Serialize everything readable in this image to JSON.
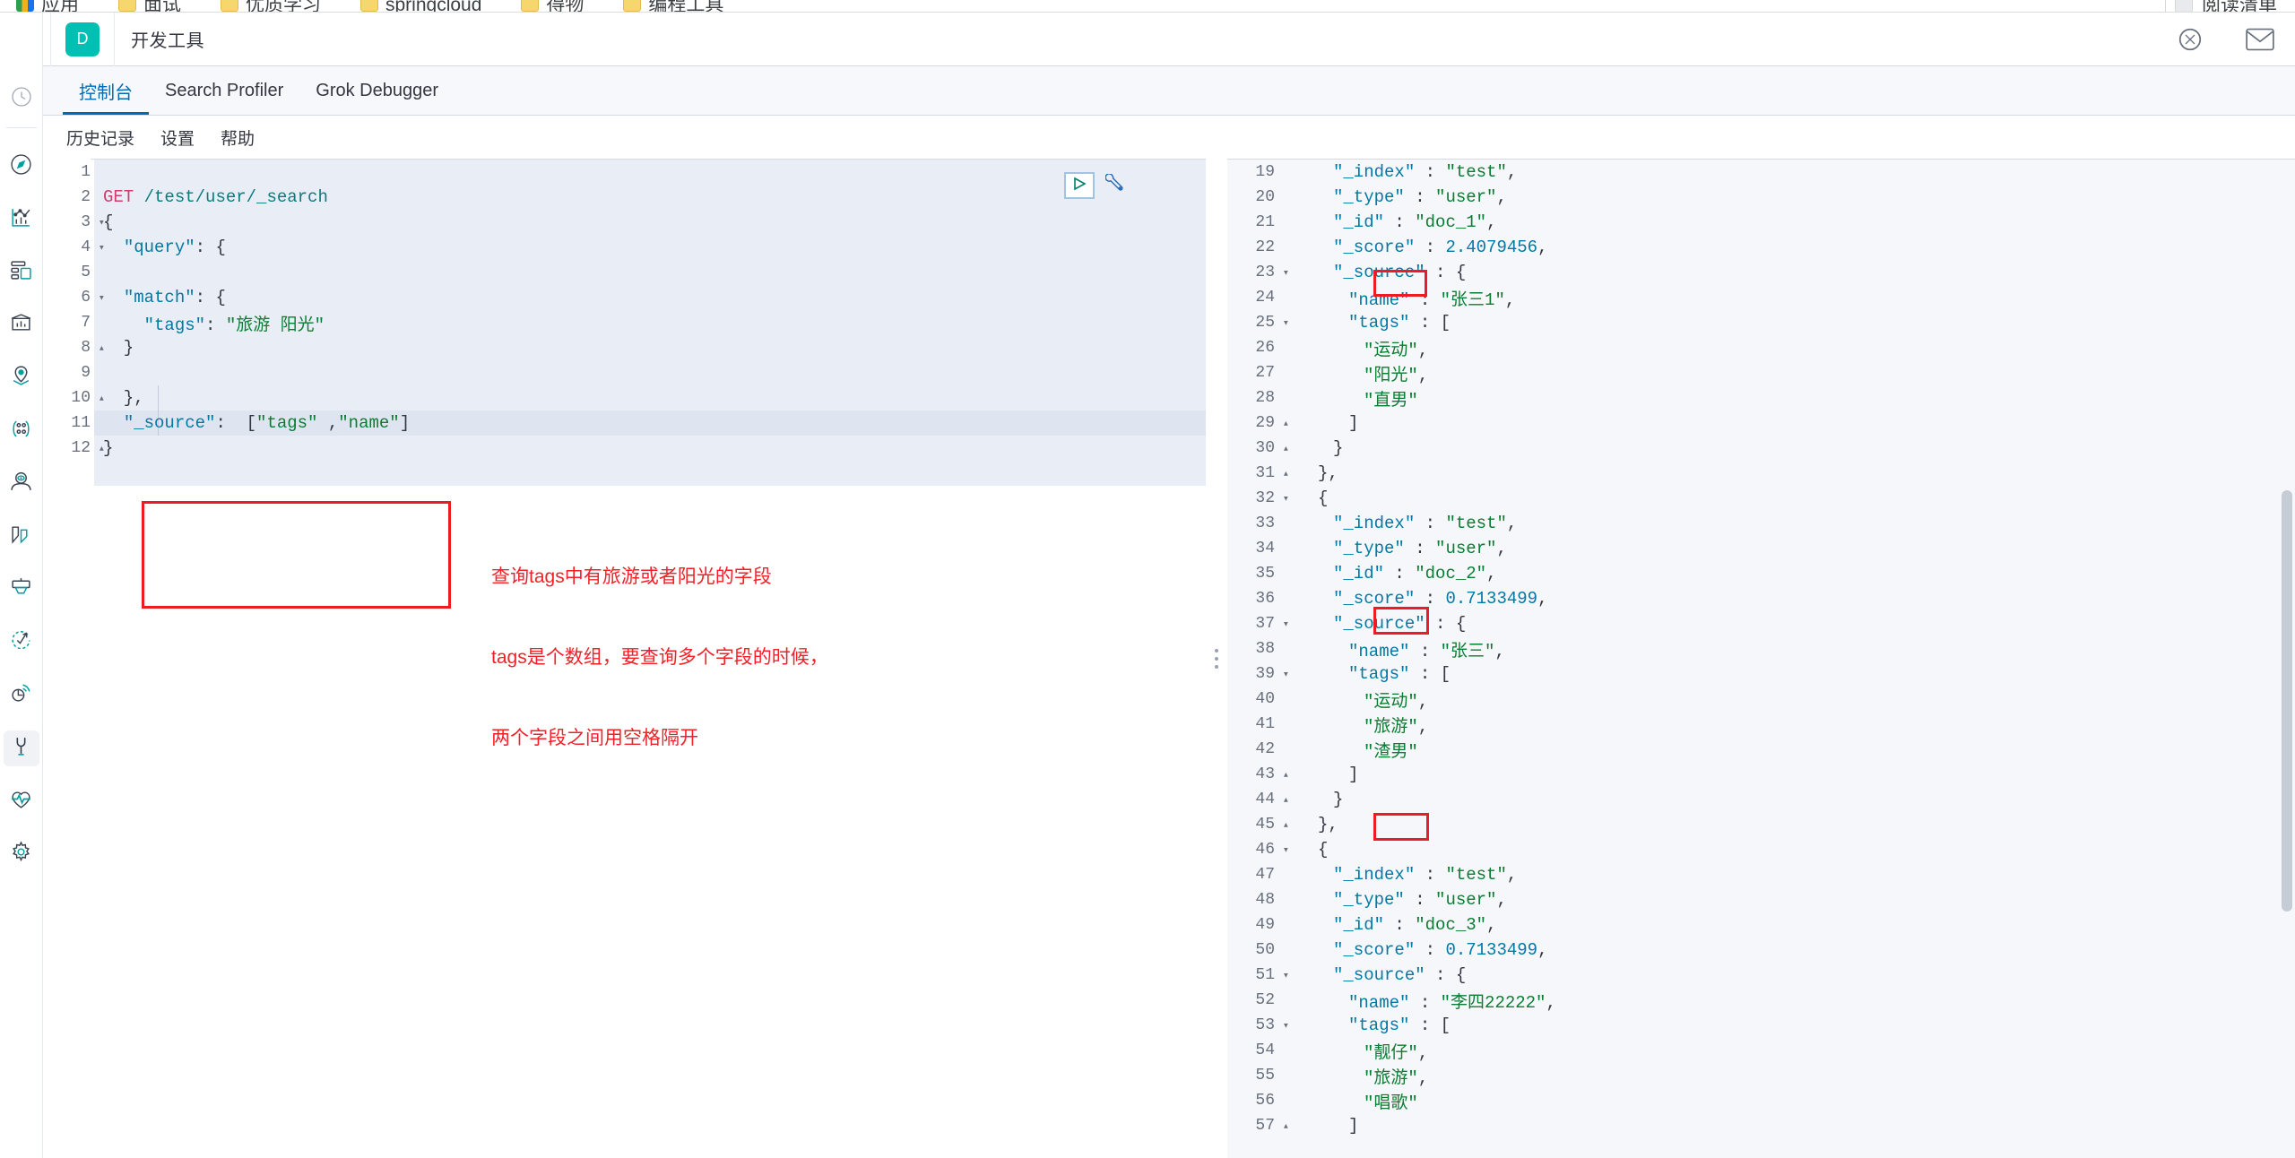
{
  "browser": {
    "bookmarks": [
      {
        "label": "应用",
        "icon": "apps-grid-icon"
      },
      {
        "label": "面试",
        "icon": "folder-icon"
      },
      {
        "label": "优质学习",
        "icon": "folder-icon"
      },
      {
        "label": "springcloud",
        "icon": "folder-icon"
      },
      {
        "label": "得物",
        "icon": "folder-icon"
      },
      {
        "label": "编程工具",
        "icon": "folder-icon"
      }
    ],
    "reading_list": "阅读清单"
  },
  "header": {
    "logo": "kibana-logo",
    "space_initial": "D",
    "app_title": "开发工具",
    "icons": [
      "help-circle-icon",
      "mail-icon"
    ]
  },
  "sidebar": {
    "items": [
      {
        "name": "recently-viewed",
        "icon": "clock-icon",
        "active": false
      },
      {
        "name": "discover",
        "icon": "compass-icon",
        "active": false
      },
      {
        "name": "visualize",
        "icon": "bar-line-chart-icon",
        "active": false
      },
      {
        "name": "dashboard",
        "icon": "dashboard-panels-icon",
        "active": false
      },
      {
        "name": "canvas",
        "icon": "presentation-icon",
        "active": false
      },
      {
        "name": "maps",
        "icon": "map-pin-icon",
        "active": false
      },
      {
        "name": "graph",
        "icon": "graph-nodes-icon",
        "active": false
      },
      {
        "name": "machine-learning",
        "icon": "ml-person-icon",
        "active": false
      },
      {
        "name": "infrastructure",
        "icon": "infrastructure-icon",
        "active": false
      },
      {
        "name": "logs",
        "icon": "logs-console-icon",
        "active": false
      },
      {
        "name": "uptime",
        "icon": "uptime-check-icon",
        "active": false
      },
      {
        "name": "apm",
        "icon": "apm-signal-icon",
        "active": false
      },
      {
        "name": "dev-tools",
        "icon": "wrench-icon",
        "active": true
      },
      {
        "name": "monitoring",
        "icon": "heartbeat-icon",
        "active": false
      },
      {
        "name": "management",
        "icon": "gear-icon",
        "active": false
      }
    ]
  },
  "tabs": [
    {
      "label": "控制台",
      "active": true
    },
    {
      "label": "Search Profiler",
      "active": false
    },
    {
      "label": "Grok Debugger",
      "active": false
    }
  ],
  "menu": [
    {
      "label": "历史记录"
    },
    {
      "label": "设置"
    },
    {
      "label": "帮助"
    }
  ],
  "editor_actions": {
    "play": "send-request-play-icon",
    "wrench": "open-documentation-wrench-icon"
  },
  "request_editor": {
    "lines": [
      {
        "n": "1",
        "fold": "",
        "tokens": []
      },
      {
        "n": "2",
        "fold": "",
        "tokens": [
          {
            "t": "method",
            "v": "GET"
          },
          {
            "t": "plain",
            "v": " "
          },
          {
            "t": "url",
            "v": "/test/user/_search"
          }
        ]
      },
      {
        "n": "3",
        "fold": "▾",
        "tokens": [
          {
            "t": "punc",
            "v": "{"
          }
        ]
      },
      {
        "n": "4",
        "fold": "▾",
        "tokens": [
          {
            "t": "punc",
            "v": "  "
          },
          {
            "t": "key",
            "v": "\"query\""
          },
          {
            "t": "punc",
            "v": ": {"
          }
        ]
      },
      {
        "n": "5",
        "fold": "",
        "tokens": []
      },
      {
        "n": "6",
        "fold": "▾",
        "tokens": [
          {
            "t": "punc",
            "v": "  "
          },
          {
            "t": "key",
            "v": "\"match\""
          },
          {
            "t": "punc",
            "v": ": {"
          }
        ]
      },
      {
        "n": "7",
        "fold": "",
        "tokens": [
          {
            "t": "punc",
            "v": "    "
          },
          {
            "t": "key",
            "v": "\"tags\""
          },
          {
            "t": "punc",
            "v": ": "
          },
          {
            "t": "str",
            "v": "\"旅游 阳光\""
          }
        ]
      },
      {
        "n": "8",
        "fold": "▴",
        "tokens": [
          {
            "t": "punc",
            "v": "  }"
          }
        ]
      },
      {
        "n": "9",
        "fold": "",
        "tokens": []
      },
      {
        "n": "10",
        "fold": "▴",
        "tokens": [
          {
            "t": "punc",
            "v": "  },"
          }
        ]
      },
      {
        "n": "11",
        "fold": "",
        "tokens": [
          {
            "t": "punc",
            "v": "  "
          },
          {
            "t": "key",
            "v": "\"_source\""
          },
          {
            "t": "punc",
            "v": ":  ["
          },
          {
            "t": "str",
            "v": "\"tags\""
          },
          {
            "t": "punc",
            "v": " ,"
          },
          {
            "t": "str",
            "v": "\"name\""
          },
          {
            "t": "punc",
            "v": "]"
          }
        ]
      },
      {
        "n": "12",
        "fold": "▴",
        "tokens": [
          {
            "t": "punc",
            "v": "}"
          }
        ]
      }
    ],
    "highlighted_line": "11"
  },
  "annotation": {
    "color": "#f42028",
    "lines": [
      "查询tags中有旅游或者阳光的字段",
      "tags是个数组，要查询多个字段的时候，",
      "两个字段之间用空格隔开"
    ]
  },
  "response_viewer": {
    "lines": [
      {
        "n": "19",
        "fold": "",
        "indent": 3,
        "tokens": [
          {
            "t": "key",
            "v": "\"_index\""
          },
          {
            "t": "punc",
            "v": " : "
          },
          {
            "t": "str",
            "v": "\"test\""
          },
          {
            "t": "punc",
            "v": ","
          }
        ]
      },
      {
        "n": "20",
        "fold": "",
        "indent": 3,
        "tokens": [
          {
            "t": "key",
            "v": "\"_type\""
          },
          {
            "t": "punc",
            "v": " : "
          },
          {
            "t": "str",
            "v": "\"user\""
          },
          {
            "t": "punc",
            "v": ","
          }
        ]
      },
      {
        "n": "21",
        "fold": "",
        "indent": 3,
        "tokens": [
          {
            "t": "key",
            "v": "\"_id\""
          },
          {
            "t": "punc",
            "v": " : "
          },
          {
            "t": "str",
            "v": "\"doc_1\""
          },
          {
            "t": "punc",
            "v": ","
          }
        ]
      },
      {
        "n": "22",
        "fold": "",
        "indent": 3,
        "tokens": [
          {
            "t": "key",
            "v": "\"_score\""
          },
          {
            "t": "punc",
            "v": " : "
          },
          {
            "t": "num",
            "v": "2.4079456"
          },
          {
            "t": "punc",
            "v": ","
          }
        ]
      },
      {
        "n": "23",
        "fold": "▾",
        "indent": 3,
        "tokens": [
          {
            "t": "key",
            "v": "\"_source\""
          },
          {
            "t": "punc",
            "v": " : {"
          }
        ]
      },
      {
        "n": "24",
        "fold": "",
        "indent": 4,
        "tokens": [
          {
            "t": "key",
            "v": "\"name\""
          },
          {
            "t": "punc",
            "v": " : "
          },
          {
            "t": "str",
            "v": "\"张三1\""
          },
          {
            "t": "punc",
            "v": ","
          }
        ]
      },
      {
        "n": "25",
        "fold": "▾",
        "indent": 4,
        "tokens": [
          {
            "t": "key",
            "v": "\"tags\""
          },
          {
            "t": "punc",
            "v": " : ["
          }
        ]
      },
      {
        "n": "26",
        "fold": "",
        "indent": 5,
        "tokens": [
          {
            "t": "str",
            "v": "\"运动\""
          },
          {
            "t": "punc",
            "v": ","
          }
        ]
      },
      {
        "n": "27",
        "fold": "",
        "indent": 5,
        "tokens": [
          {
            "t": "str",
            "v": "\"阳光\""
          },
          {
            "t": "punc",
            "v": ","
          }
        ]
      },
      {
        "n": "28",
        "fold": "",
        "indent": 5,
        "tokens": [
          {
            "t": "str",
            "v": "\"直男\""
          }
        ]
      },
      {
        "n": "29",
        "fold": "▴",
        "indent": 4,
        "tokens": [
          {
            "t": "punc",
            "v": "]"
          }
        ]
      },
      {
        "n": "30",
        "fold": "▴",
        "indent": 3,
        "tokens": [
          {
            "t": "punc",
            "v": "}"
          }
        ]
      },
      {
        "n": "31",
        "fold": "▴",
        "indent": 2,
        "tokens": [
          {
            "t": "punc",
            "v": "},"
          }
        ]
      },
      {
        "n": "32",
        "fold": "▾",
        "indent": 2,
        "tokens": [
          {
            "t": "punc",
            "v": "{"
          }
        ]
      },
      {
        "n": "33",
        "fold": "",
        "indent": 3,
        "tokens": [
          {
            "t": "key",
            "v": "\"_index\""
          },
          {
            "t": "punc",
            "v": " : "
          },
          {
            "t": "str",
            "v": "\"test\""
          },
          {
            "t": "punc",
            "v": ","
          }
        ]
      },
      {
        "n": "34",
        "fold": "",
        "indent": 3,
        "tokens": [
          {
            "t": "key",
            "v": "\"_type\""
          },
          {
            "t": "punc",
            "v": " : "
          },
          {
            "t": "str",
            "v": "\"user\""
          },
          {
            "t": "punc",
            "v": ","
          }
        ]
      },
      {
        "n": "35",
        "fold": "",
        "indent": 3,
        "tokens": [
          {
            "t": "key",
            "v": "\"_id\""
          },
          {
            "t": "punc",
            "v": " : "
          },
          {
            "t": "str",
            "v": "\"doc_2\""
          },
          {
            "t": "punc",
            "v": ","
          }
        ]
      },
      {
        "n": "36",
        "fold": "",
        "indent": 3,
        "tokens": [
          {
            "t": "key",
            "v": "\"_score\""
          },
          {
            "t": "punc",
            "v": " : "
          },
          {
            "t": "num",
            "v": "0.7133499"
          },
          {
            "t": "punc",
            "v": ","
          }
        ]
      },
      {
        "n": "37",
        "fold": "▾",
        "indent": 3,
        "tokens": [
          {
            "t": "key",
            "v": "\"_source\""
          },
          {
            "t": "punc",
            "v": " : {"
          }
        ]
      },
      {
        "n": "38",
        "fold": "",
        "indent": 4,
        "tokens": [
          {
            "t": "key",
            "v": "\"name\""
          },
          {
            "t": "punc",
            "v": " : "
          },
          {
            "t": "str",
            "v": "\"张三\""
          },
          {
            "t": "punc",
            "v": ","
          }
        ]
      },
      {
        "n": "39",
        "fold": "▾",
        "indent": 4,
        "tokens": [
          {
            "t": "key",
            "v": "\"tags\""
          },
          {
            "t": "punc",
            "v": " : ["
          }
        ]
      },
      {
        "n": "40",
        "fold": "",
        "indent": 5,
        "tokens": [
          {
            "t": "str",
            "v": "\"运动\""
          },
          {
            "t": "punc",
            "v": ","
          }
        ]
      },
      {
        "n": "41",
        "fold": "",
        "indent": 5,
        "tokens": [
          {
            "t": "str",
            "v": "\"旅游\""
          },
          {
            "t": "punc",
            "v": ","
          }
        ]
      },
      {
        "n": "42",
        "fold": "",
        "indent": 5,
        "tokens": [
          {
            "t": "str",
            "v": "\"渣男\""
          }
        ]
      },
      {
        "n": "43",
        "fold": "▴",
        "indent": 4,
        "tokens": [
          {
            "t": "punc",
            "v": "]"
          }
        ]
      },
      {
        "n": "44",
        "fold": "▴",
        "indent": 3,
        "tokens": [
          {
            "t": "punc",
            "v": "}"
          }
        ]
      },
      {
        "n": "45",
        "fold": "▴",
        "indent": 2,
        "tokens": [
          {
            "t": "punc",
            "v": "},"
          }
        ]
      },
      {
        "n": "46",
        "fold": "▾",
        "indent": 2,
        "tokens": [
          {
            "t": "punc",
            "v": "{"
          }
        ]
      },
      {
        "n": "47",
        "fold": "",
        "indent": 3,
        "tokens": [
          {
            "t": "key",
            "v": "\"_index\""
          },
          {
            "t": "punc",
            "v": " : "
          },
          {
            "t": "str",
            "v": "\"test\""
          },
          {
            "t": "punc",
            "v": ","
          }
        ]
      },
      {
        "n": "48",
        "fold": "",
        "indent": 3,
        "tokens": [
          {
            "t": "key",
            "v": "\"_type\""
          },
          {
            "t": "punc",
            "v": " : "
          },
          {
            "t": "str",
            "v": "\"user\""
          },
          {
            "t": "punc",
            "v": ","
          }
        ]
      },
      {
        "n": "49",
        "fold": "",
        "indent": 3,
        "tokens": [
          {
            "t": "key",
            "v": "\"_id\""
          },
          {
            "t": "punc",
            "v": " : "
          },
          {
            "t": "str",
            "v": "\"doc_3\""
          },
          {
            "t": "punc",
            "v": ","
          }
        ]
      },
      {
        "n": "50",
        "fold": "",
        "indent": 3,
        "tokens": [
          {
            "t": "key",
            "v": "\"_score\""
          },
          {
            "t": "punc",
            "v": " : "
          },
          {
            "t": "num",
            "v": "0.7133499"
          },
          {
            "t": "punc",
            "v": ","
          }
        ]
      },
      {
        "n": "51",
        "fold": "▾",
        "indent": 3,
        "tokens": [
          {
            "t": "key",
            "v": "\"_source\""
          },
          {
            "t": "punc",
            "v": " : {"
          }
        ]
      },
      {
        "n": "52",
        "fold": "",
        "indent": 4,
        "tokens": [
          {
            "t": "key",
            "v": "\"name\""
          },
          {
            "t": "punc",
            "v": " : "
          },
          {
            "t": "str",
            "v": "\"李四22222\""
          },
          {
            "t": "punc",
            "v": ","
          }
        ]
      },
      {
        "n": "53",
        "fold": "▾",
        "indent": 4,
        "tokens": [
          {
            "t": "key",
            "v": "\"tags\""
          },
          {
            "t": "punc",
            "v": " : ["
          }
        ]
      },
      {
        "n": "54",
        "fold": "",
        "indent": 5,
        "tokens": [
          {
            "t": "str",
            "v": "\"靓仔\""
          },
          {
            "t": "punc",
            "v": ","
          }
        ]
      },
      {
        "n": "55",
        "fold": "",
        "indent": 5,
        "tokens": [
          {
            "t": "str",
            "v": "\"旅游\""
          },
          {
            "t": "punc",
            "v": ","
          }
        ]
      },
      {
        "n": "56",
        "fold": "",
        "indent": 5,
        "tokens": [
          {
            "t": "str",
            "v": "\"唱歌\""
          }
        ]
      },
      {
        "n": "57",
        "fold": "▴",
        "indent": 4,
        "tokens": [
          {
            "t": "punc",
            "v": "]"
          }
        ]
      }
    ]
  },
  "highlights": [
    {
      "name": "match-query-highlight",
      "target": "request lines 6-9"
    },
    {
      "name": "result-tag-yangguang-highlight",
      "target": "response line 27"
    },
    {
      "name": "result-tag-lvyou-doc2-highlight",
      "target": "response line 41"
    },
    {
      "name": "result-tag-lvyou-doc3-highlight",
      "target": "response line 55"
    }
  ],
  "colors": {
    "accent": "#006bb4",
    "brand_teal": "#00bfb3",
    "annotation_red": "#f42028",
    "string_green": "#0a7d32",
    "key_blue": "#0079a5",
    "method_pink": "#d13b6e"
  }
}
